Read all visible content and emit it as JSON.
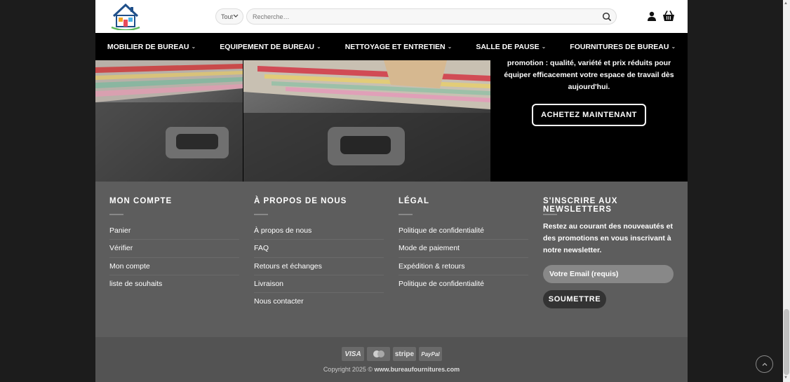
{
  "header": {
    "category_label": "Tout",
    "search_placeholder": "Recherche…"
  },
  "nav": [
    {
      "label": "MOBILIER DE BUREAU"
    },
    {
      "label": "EQUIPEMENT DE BUREAU"
    },
    {
      "label": "NETTOYAGE ET ENTRETIEN"
    },
    {
      "label": "SALLE DE PAUSE"
    },
    {
      "label": "FOURNITURES DE BUREAU"
    }
  ],
  "hero": {
    "promo_line1": "promotion : qualité, variété et prix réduits pour",
    "promo_line2": "équiper efficacement votre espace de travail dès",
    "promo_line3": "aujourd'hui.",
    "cta_label": "ACHETEZ MAINTENANT"
  },
  "footer": {
    "account": {
      "title": "MON COMPTE",
      "links": [
        "Panier",
        "Vérifier",
        "Mon compte",
        "liste de souhaits"
      ]
    },
    "about": {
      "title": "À PROPOS DE NOUS",
      "links": [
        "À propos de nous",
        "FAQ",
        "Retours et échanges",
        "Livraison",
        "Nous contacter"
      ]
    },
    "legal": {
      "title": "LÉGAL",
      "links": [
        "Politique de confidentialité",
        "Mode de paiement",
        "Expédition & retours",
        "Politique de confidentialité"
      ]
    },
    "newsletter": {
      "title": "S'INSCRIRE AUX NEWSLETTERS",
      "text": "Restez au courant des nouveautés et des promotions en vous inscrivant à notre newsletter.",
      "email_placeholder": "Votre Email (requis)",
      "submit_label": "SOUMETTRE"
    }
  },
  "bottom": {
    "payments": [
      "VISA",
      "mastercard",
      "stripe",
      "PayPal"
    ],
    "copyright_prefix": "Copyright 2025 ©",
    "copyright_site": "www.bureaufournitures.com"
  },
  "colors": {
    "page_bg": "#1c1c1c",
    "footer_bg": "#5d5d5d",
    "nav_bg": "#000000",
    "bottom_bg": "#535353"
  }
}
